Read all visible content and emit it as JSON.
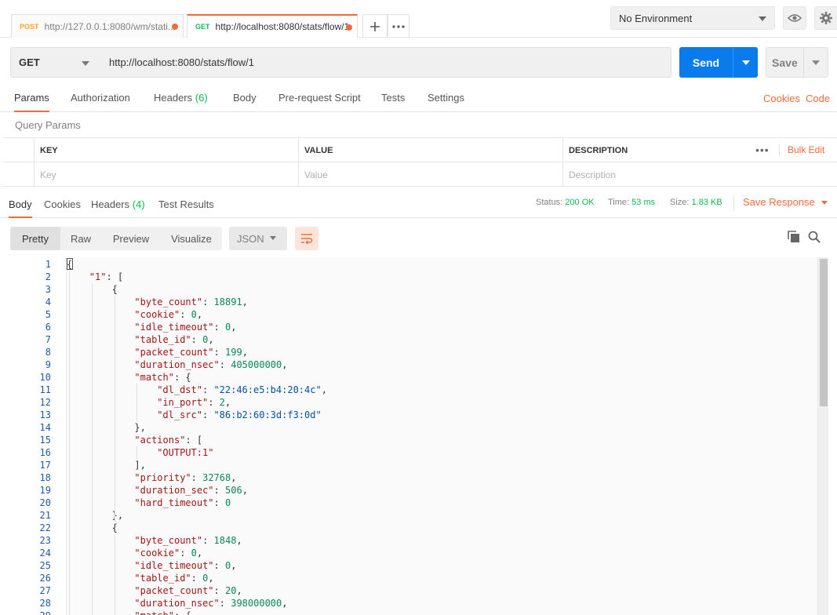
{
  "tabs": [
    {
      "method": "POST",
      "url": "http://127.0.0.1:8080/wm/stati..."
    },
    {
      "method": "GET",
      "url": "http://localhost:8080/stats/flow/1"
    }
  ],
  "environment": {
    "selected": "No Environment"
  },
  "request": {
    "method": "GET",
    "url": "http://localhost:8080/stats/flow/1",
    "send_label": "Send",
    "save_label": "Save"
  },
  "request_tabs": {
    "params": "Params",
    "authorization": "Authorization",
    "headers": "Headers",
    "headers_count": "(6)",
    "body": "Body",
    "prerequest": "Pre-request Script",
    "tests": "Tests",
    "settings": "Settings",
    "cookies": "Cookies",
    "code": "Code"
  },
  "query_params": {
    "title": "Query Params",
    "columns": {
      "key": "KEY",
      "value": "VALUE",
      "description": "DESCRIPTION"
    },
    "placeholders": {
      "key": "Key",
      "value": "Value",
      "description": "Description"
    },
    "bulk_edit": "Bulk Edit"
  },
  "response_tabs": {
    "body": "Body",
    "cookies": "Cookies",
    "headers": "Headers",
    "headers_count": "(4)",
    "test_results": "Test Results"
  },
  "response_meta": {
    "status_label": "Status:",
    "status": "200 OK",
    "time_label": "Time:",
    "time": "53 ms",
    "size_label": "Size:",
    "size": "1.83 KB",
    "save_response": "Save Response"
  },
  "body_toolbar": {
    "pretty": "Pretty",
    "raw": "Raw",
    "preview": "Preview",
    "visualize": "Visualize",
    "format": "JSON"
  },
  "code_lines": [
    {
      "n": "1",
      "indent": 0,
      "tokens": [
        [
          "p",
          "{"
        ]
      ]
    },
    {
      "n": "2",
      "indent": 1,
      "tokens": [
        [
          "k",
          "\"1\""
        ],
        [
          "p",
          ": ["
        ]
      ]
    },
    {
      "n": "3",
      "indent": 2,
      "tokens": [
        [
          "p",
          "{"
        ]
      ]
    },
    {
      "n": "4",
      "indent": 3,
      "tokens": [
        [
          "k",
          "\"byte_count\""
        ],
        [
          "p",
          ": "
        ],
        [
          "n",
          "18891"
        ],
        [
          "p",
          ","
        ]
      ]
    },
    {
      "n": "5",
      "indent": 3,
      "tokens": [
        [
          "k",
          "\"cookie\""
        ],
        [
          "p",
          ": "
        ],
        [
          "n",
          "0"
        ],
        [
          "p",
          ","
        ]
      ]
    },
    {
      "n": "6",
      "indent": 3,
      "tokens": [
        [
          "k",
          "\"idle_timeout\""
        ],
        [
          "p",
          ": "
        ],
        [
          "n",
          "0"
        ],
        [
          "p",
          ","
        ]
      ]
    },
    {
      "n": "7",
      "indent": 3,
      "tokens": [
        [
          "k",
          "\"table_id\""
        ],
        [
          "p",
          ": "
        ],
        [
          "n",
          "0"
        ],
        [
          "p",
          ","
        ]
      ]
    },
    {
      "n": "8",
      "indent": 3,
      "tokens": [
        [
          "k",
          "\"packet_count\""
        ],
        [
          "p",
          ": "
        ],
        [
          "n",
          "199"
        ],
        [
          "p",
          ","
        ]
      ]
    },
    {
      "n": "9",
      "indent": 3,
      "tokens": [
        [
          "k",
          "\"duration_nsec\""
        ],
        [
          "p",
          ": "
        ],
        [
          "n",
          "405000000"
        ],
        [
          "p",
          ","
        ]
      ]
    },
    {
      "n": "10",
      "indent": 3,
      "tokens": [
        [
          "k",
          "\"match\""
        ],
        [
          "p",
          ": {"
        ]
      ]
    },
    {
      "n": "11",
      "indent": 4,
      "tokens": [
        [
          "k",
          "\"dl_dst\""
        ],
        [
          "p",
          ": "
        ],
        [
          "s",
          "\"22:46:e5:b4:20:4c\""
        ],
        [
          "p",
          ","
        ]
      ]
    },
    {
      "n": "12",
      "indent": 4,
      "tokens": [
        [
          "k",
          "\"in_port\""
        ],
        [
          "p",
          ": "
        ],
        [
          "n",
          "2"
        ],
        [
          "p",
          ","
        ]
      ]
    },
    {
      "n": "13",
      "indent": 4,
      "tokens": [
        [
          "k",
          "\"dl_src\""
        ],
        [
          "p",
          ": "
        ],
        [
          "s",
          "\"86:b2:60:3d:f3:0d\""
        ]
      ]
    },
    {
      "n": "14",
      "indent": 3,
      "tokens": [
        [
          "p",
          "},"
        ]
      ]
    },
    {
      "n": "15",
      "indent": 3,
      "tokens": [
        [
          "k",
          "\"actions\""
        ],
        [
          "p",
          ": ["
        ]
      ]
    },
    {
      "n": "16",
      "indent": 4,
      "tokens": [
        [
          "k",
          "\"OUTPUT:1\""
        ]
      ]
    },
    {
      "n": "17",
      "indent": 3,
      "tokens": [
        [
          "p",
          "],"
        ]
      ]
    },
    {
      "n": "18",
      "indent": 3,
      "tokens": [
        [
          "k",
          "\"priority\""
        ],
        [
          "p",
          ": "
        ],
        [
          "n",
          "32768"
        ],
        [
          "p",
          ","
        ]
      ]
    },
    {
      "n": "19",
      "indent": 3,
      "tokens": [
        [
          "k",
          "\"duration_sec\""
        ],
        [
          "p",
          ": "
        ],
        [
          "n",
          "506"
        ],
        [
          "p",
          ","
        ]
      ]
    },
    {
      "n": "20",
      "indent": 3,
      "tokens": [
        [
          "k",
          "\"hard_timeout\""
        ],
        [
          "p",
          ": "
        ],
        [
          "n",
          "0"
        ]
      ]
    },
    {
      "n": "21",
      "indent": 2,
      "tokens": [
        [
          "p",
          "},"
        ]
      ]
    },
    {
      "n": "22",
      "indent": 2,
      "tokens": [
        [
          "p",
          "{"
        ]
      ]
    },
    {
      "n": "23",
      "indent": 3,
      "tokens": [
        [
          "k",
          "\"byte_count\""
        ],
        [
          "p",
          ": "
        ],
        [
          "n",
          "1848"
        ],
        [
          "p",
          ","
        ]
      ]
    },
    {
      "n": "24",
      "indent": 3,
      "tokens": [
        [
          "k",
          "\"cookie\""
        ],
        [
          "p",
          ": "
        ],
        [
          "n",
          "0"
        ],
        [
          "p",
          ","
        ]
      ]
    },
    {
      "n": "25",
      "indent": 3,
      "tokens": [
        [
          "k",
          "\"idle_timeout\""
        ],
        [
          "p",
          ": "
        ],
        [
          "n",
          "0"
        ],
        [
          "p",
          ","
        ]
      ]
    },
    {
      "n": "26",
      "indent": 3,
      "tokens": [
        [
          "k",
          "\"table_id\""
        ],
        [
          "p",
          ": "
        ],
        [
          "n",
          "0"
        ],
        [
          "p",
          ","
        ]
      ]
    },
    {
      "n": "27",
      "indent": 3,
      "tokens": [
        [
          "k",
          "\"packet_count\""
        ],
        [
          "p",
          ": "
        ],
        [
          "n",
          "20"
        ],
        [
          "p",
          ","
        ]
      ]
    },
    {
      "n": "28",
      "indent": 3,
      "tokens": [
        [
          "k",
          "\"duration_nsec\""
        ],
        [
          "p",
          ": "
        ],
        [
          "n",
          "398000000"
        ],
        [
          "p",
          ","
        ]
      ]
    },
    {
      "n": "29",
      "indent": 3,
      "tokens": [
        [
          "k",
          "\"match\""
        ],
        [
          "p",
          ": {"
        ]
      ]
    }
  ]
}
